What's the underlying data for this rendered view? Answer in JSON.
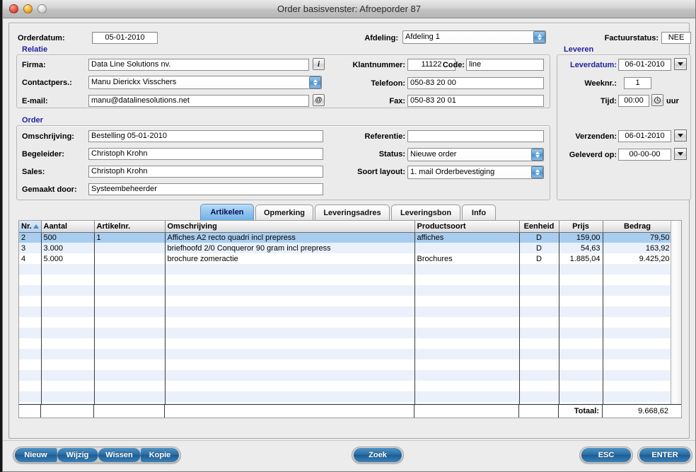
{
  "window": {
    "title": "Order basisvenster: Afroeporder 87",
    "traffic": [
      "close-button",
      "minimize-button",
      "zoom-button"
    ]
  },
  "top": {
    "orderdatum_label": "Orderdatum:",
    "orderdatum_value": "05-01-2010",
    "afdeling_label": "Afdeling:",
    "afdeling_value": "Afdeling 1",
    "factuurstatus_label": "Factuurstatus:",
    "factuurstatus_value": "NEE"
  },
  "relatie": {
    "group_label": "Relatie",
    "firma_label": "Firma:",
    "firma_value": "Data Line Solutions nv.",
    "info_button": "i",
    "contactpers_label": "Contactpers.:",
    "contactpers_value": "Manu Dierickx Visschers",
    "email_label": "E-mail:",
    "email_value": "manu@datalinesolutions.net",
    "email_button": "@",
    "klantnummer_label": "Klantnummer:",
    "klantnummer_value": "11122",
    "code_label": "Code:",
    "code_value": "line",
    "telefoon_label": "Telefoon:",
    "telefoon_value": "050-83 20 00",
    "fax_label": "Fax:",
    "fax_value": "050-83 20 01"
  },
  "order": {
    "group_label": "Order",
    "omschrijving_label": "Omschrijving:",
    "omschrijving_value": "Bestelling 05-01-2010",
    "begeleider_label": "Begeleider:",
    "begeleider_value": "Christoph Krohn",
    "sales_label": "Sales:",
    "sales_value": "Christoph Krohn",
    "gemaakt_label": "Gemaakt door:",
    "gemaakt_value": "Systeembeheerder",
    "referentie_label": "Referentie:",
    "referentie_value": "",
    "status_label": "Status:",
    "status_value": "Nieuwe order",
    "soortlayout_label": "Soort layout:",
    "soortlayout_value": "1. mail Orderbevestiging"
  },
  "leveren": {
    "group_label": "Leveren",
    "leverdatum_label": "Leverdatum:",
    "leverdatum_value": "06-01-2010",
    "weeknr_label": "Weeknr.:",
    "weeknr_value": "1",
    "tijd_label": "Tijd:",
    "tijd_value": "00:00",
    "tijd_suffix": "uur",
    "verzenden_label": "Verzenden:",
    "verzenden_value": "06-01-2010",
    "geleverd_label": "Geleverd op:",
    "geleverd_value": "00-00-00"
  },
  "tabs": [
    {
      "label": "Artikelen",
      "active": true
    },
    {
      "label": "Opmerking",
      "active": false
    },
    {
      "label": "Leveringsadres",
      "active": false
    },
    {
      "label": "Leveringsbon",
      "active": false
    },
    {
      "label": "Info",
      "active": false
    }
  ],
  "table": {
    "columns": [
      "Nr.",
      "Aantal",
      "Artikelnr.",
      "Omschrijving",
      "Productsoort",
      "Eenheid",
      "Prijs",
      "Bedrag"
    ],
    "sort_column": "Nr.",
    "sort_direction": "asc",
    "rows": [
      {
        "nr": "2",
        "aantal": "500",
        "artikelnr": "1",
        "omschrijving": "Affiches A2 recto quadri incl prepress",
        "productsoort": "affiches",
        "eenheid": "D",
        "prijs": "159,00",
        "bedrag": "79,50",
        "selected": true
      },
      {
        "nr": "3",
        "aantal": "3.000",
        "artikelnr": "",
        "omschrijving": "briefhoofd 2/0 Conqueror 90 gram incl prepress",
        "productsoort": "",
        "eenheid": "D",
        "prijs": "54,63",
        "bedrag": "163,92",
        "selected": false
      },
      {
        "nr": "4",
        "aantal": "5.000",
        "artikelnr": "",
        "omschrijving": "brochure zomeractie",
        "productsoort": "Brochures",
        "eenheid": "D",
        "prijs": "1.885,04",
        "bedrag": "9.425,20",
        "selected": false
      }
    ],
    "total_label": "Totaal:",
    "total_value": "9.668,62",
    "empty_row_count": 15
  },
  "buttons": {
    "left_group": [
      "Nieuw",
      "Wijzig",
      "Wissen",
      "Kopie"
    ],
    "search": "Zoek",
    "esc": "ESC",
    "enter": "ENTER"
  },
  "colors": {
    "group_label": "#23239c",
    "selection": "#a8cdf0",
    "zebra": "#eaf1fb",
    "button_blue": "#2b6fa6"
  }
}
